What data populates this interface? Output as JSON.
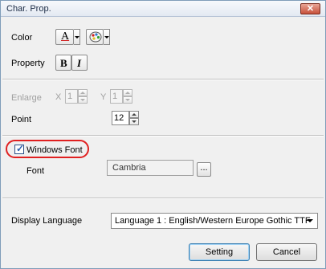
{
  "window": {
    "title": "Char. Prop."
  },
  "color": {
    "label": "Color",
    "text_color_glyph": "A"
  },
  "property": {
    "label": "Property",
    "bold_label": "B",
    "italic_label": "I"
  },
  "enlarge": {
    "label": "Enlarge",
    "x_label": "X",
    "x_value": "1",
    "y_label": "Y",
    "y_value": "1"
  },
  "point": {
    "label": "Point",
    "value": "12"
  },
  "windows_font": {
    "label": "Windows Font",
    "checked": true
  },
  "font": {
    "label": "Font",
    "value": "Cambria",
    "browse_label": "..."
  },
  "display_language": {
    "label": "Display Language",
    "selected": "Language 1 : English/Western Europe Gothic TTF"
  },
  "buttons": {
    "setting": "Setting",
    "cancel": "Cancel"
  },
  "colors": {
    "highlight": "#e02020",
    "text_underline": "#d02020"
  }
}
